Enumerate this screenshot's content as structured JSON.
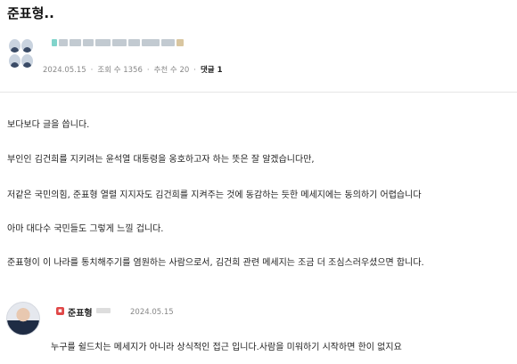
{
  "post": {
    "title": "준표형..",
    "meta": {
      "date": "2024.05.15",
      "views": "조회 수 1356",
      "votes": "추천 수 20",
      "comments": "댓글 1"
    },
    "body": [
      "보다보다 글을 씁니다.",
      "부인인 김건희를 지키려는 윤석열 대통령을 옹호하고자 하는 뜻은 잘 알겠습니다만,",
      "저같은 국민의힘, 준표형 열렬 지지자도 김건희를 지켜주는 것에 동감하는 듯한 메세지에는 동의하기 어렵습니다",
      "아마 대다수 국민들도 그렇게 느낄 겁니다.",
      "준표형이 이 나라를 통치해주기를 염원하는 사람으로서, 김건희 관련 메세지는 조금 더 조심스러우셨으면 합니다."
    ]
  },
  "reply": {
    "name": "준표형",
    "date": "2024.05.15",
    "text": "누구를 쉴드치는 메세지가 아니라 상식적인 접근 입니다.사람을 미워하기 시작하면 한이 없지요"
  }
}
